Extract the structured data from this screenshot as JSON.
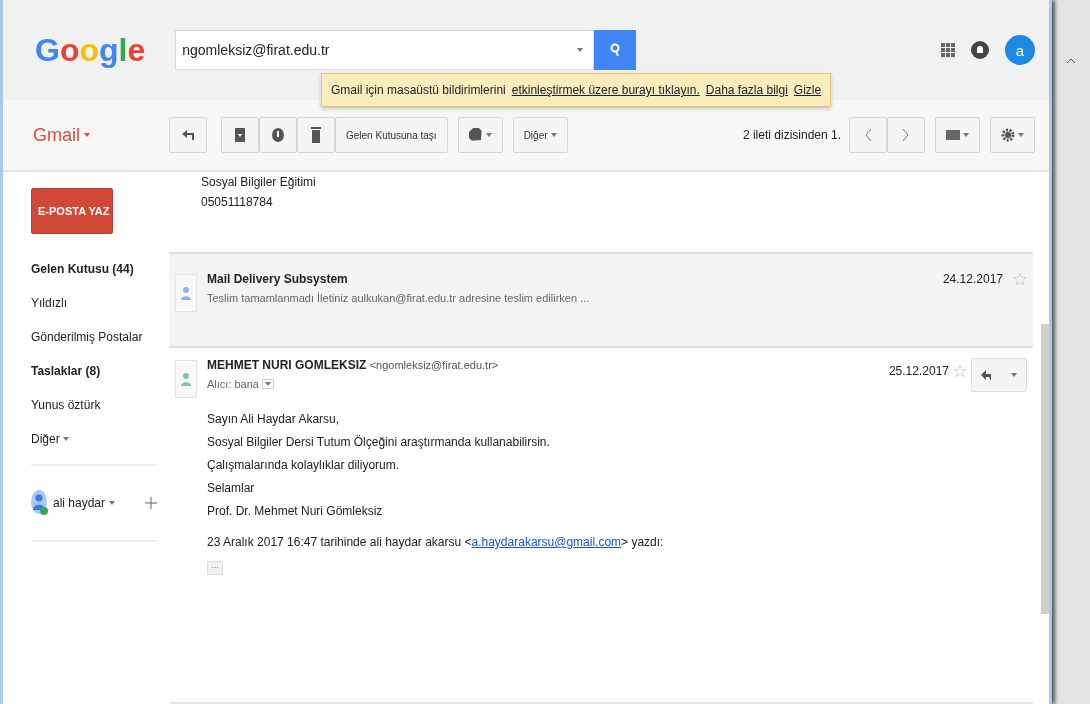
{
  "header": {
    "logo": "Google",
    "search": {
      "value": "ngomleksiz@firat.edu.tr"
    },
    "account_initial": "a"
  },
  "notification": {
    "text": "Gmail için masaüstü bildirimlerini",
    "link": "etkinleştirmek üzere burayı tıklayın.",
    "more": "Daha fazla bilgi",
    "hide": "Gizle"
  },
  "toolbar": {
    "app_menu": "Gmail",
    "buttons": [
      {
        "kind": "reply"
      },
      {
        "kind": "archive"
      },
      {
        "kind": "spam"
      },
      {
        "kind": "delete"
      },
      {
        "kind": "text",
        "label": "Gelen Kutusuna taşı"
      },
      {
        "kind": "label"
      },
      {
        "kind": "more",
        "label": "Diğer"
      }
    ],
    "count": "2 ileti dizisinden 1."
  },
  "sidebar": {
    "compose": "E-POSTA YAZ",
    "items": [
      {
        "label": "Gelen Kutusu (44)",
        "unread": true
      },
      {
        "label": "Yıldızlı",
        "unread": false
      },
      {
        "label": "Gönderilmiş Postalar",
        "unread": false
      },
      {
        "label": "Taslaklar (8)",
        "unread": true
      },
      {
        "label": "Yunus öztürk",
        "unread": false
      }
    ],
    "more": "Diğer",
    "account": "ali haydar",
    "online": true
  },
  "thread": {
    "previous_lines": [
      "Sosyal Bilgiler Eğitimi",
      "05051118784"
    ],
    "messages": [
      {
        "kind": "collapsed",
        "sender": "Mail Delivery Subsystem",
        "snippet": "Teslim tamamlanmadı İletiniz aulkukan@firat.edu.tr adresine teslim edilirken ...",
        "date": "24.12.2017",
        "starred": false,
        "color": "#8ab4f0"
      },
      {
        "kind": "expanded",
        "sender": "MEHMET NURI GOMLEKSIZ",
        "email": "<ngomleksiz@firat.edu.tr>",
        "recipient": "Alıcı: bana",
        "date": "25.12.2017",
        "starred": false,
        "color": "#7cc9a0",
        "body": [
          "Sayın Ali Haydar Akarsu,",
          "Sosyal Bilgiler Dersi Tutum Ölçeğini araştırmanda kullanabilirsin.",
          "Çalışmalarında kolaylıklar diliyorum.",
          "Selamlar",
          "Prof. Dr. Mehmet Nuri Gömleksiz"
        ],
        "quote": {
          "before": "23 Aralık 2017 16:47 tarihinde ali haydar akarsu <",
          "link": "a.haydarakarsu@gmail.com",
          "after": "> yazdı:"
        },
        "trimmed": "···"
      }
    ]
  }
}
